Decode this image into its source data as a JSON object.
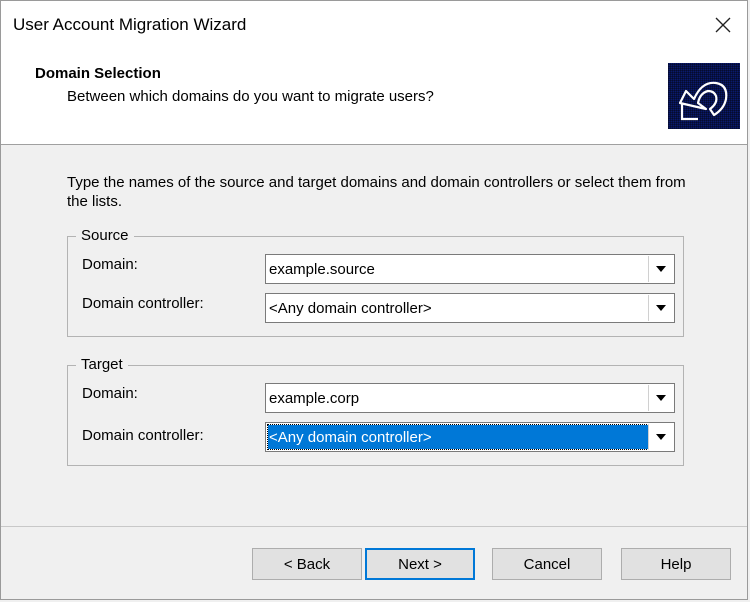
{
  "window": {
    "title": "User Account Migration Wizard"
  },
  "header": {
    "title": "Domain Selection",
    "subtitle": "Between which domains do you want to migrate users?",
    "logo_icon": "migration-arrow-icon"
  },
  "instructions": "Type the names of the source and target domains and domain controllers or select them from the lists.",
  "source": {
    "legend": "Source",
    "domain_label": "Domain:",
    "domain_value": "example.source",
    "dc_label": "Domain controller:",
    "dc_value": "<Any domain controller>"
  },
  "target": {
    "legend": "Target",
    "domain_label": "Domain:",
    "domain_value": "example.corp",
    "dc_label": "Domain controller:",
    "dc_value": "<Any domain controller>"
  },
  "buttons": {
    "back": "< Back",
    "next": "Next >",
    "cancel": "Cancel",
    "help": "Help"
  },
  "colors": {
    "selection": "#0078d7",
    "logo_background": "#0a1a6b",
    "default_button_border": "#0078d7"
  }
}
